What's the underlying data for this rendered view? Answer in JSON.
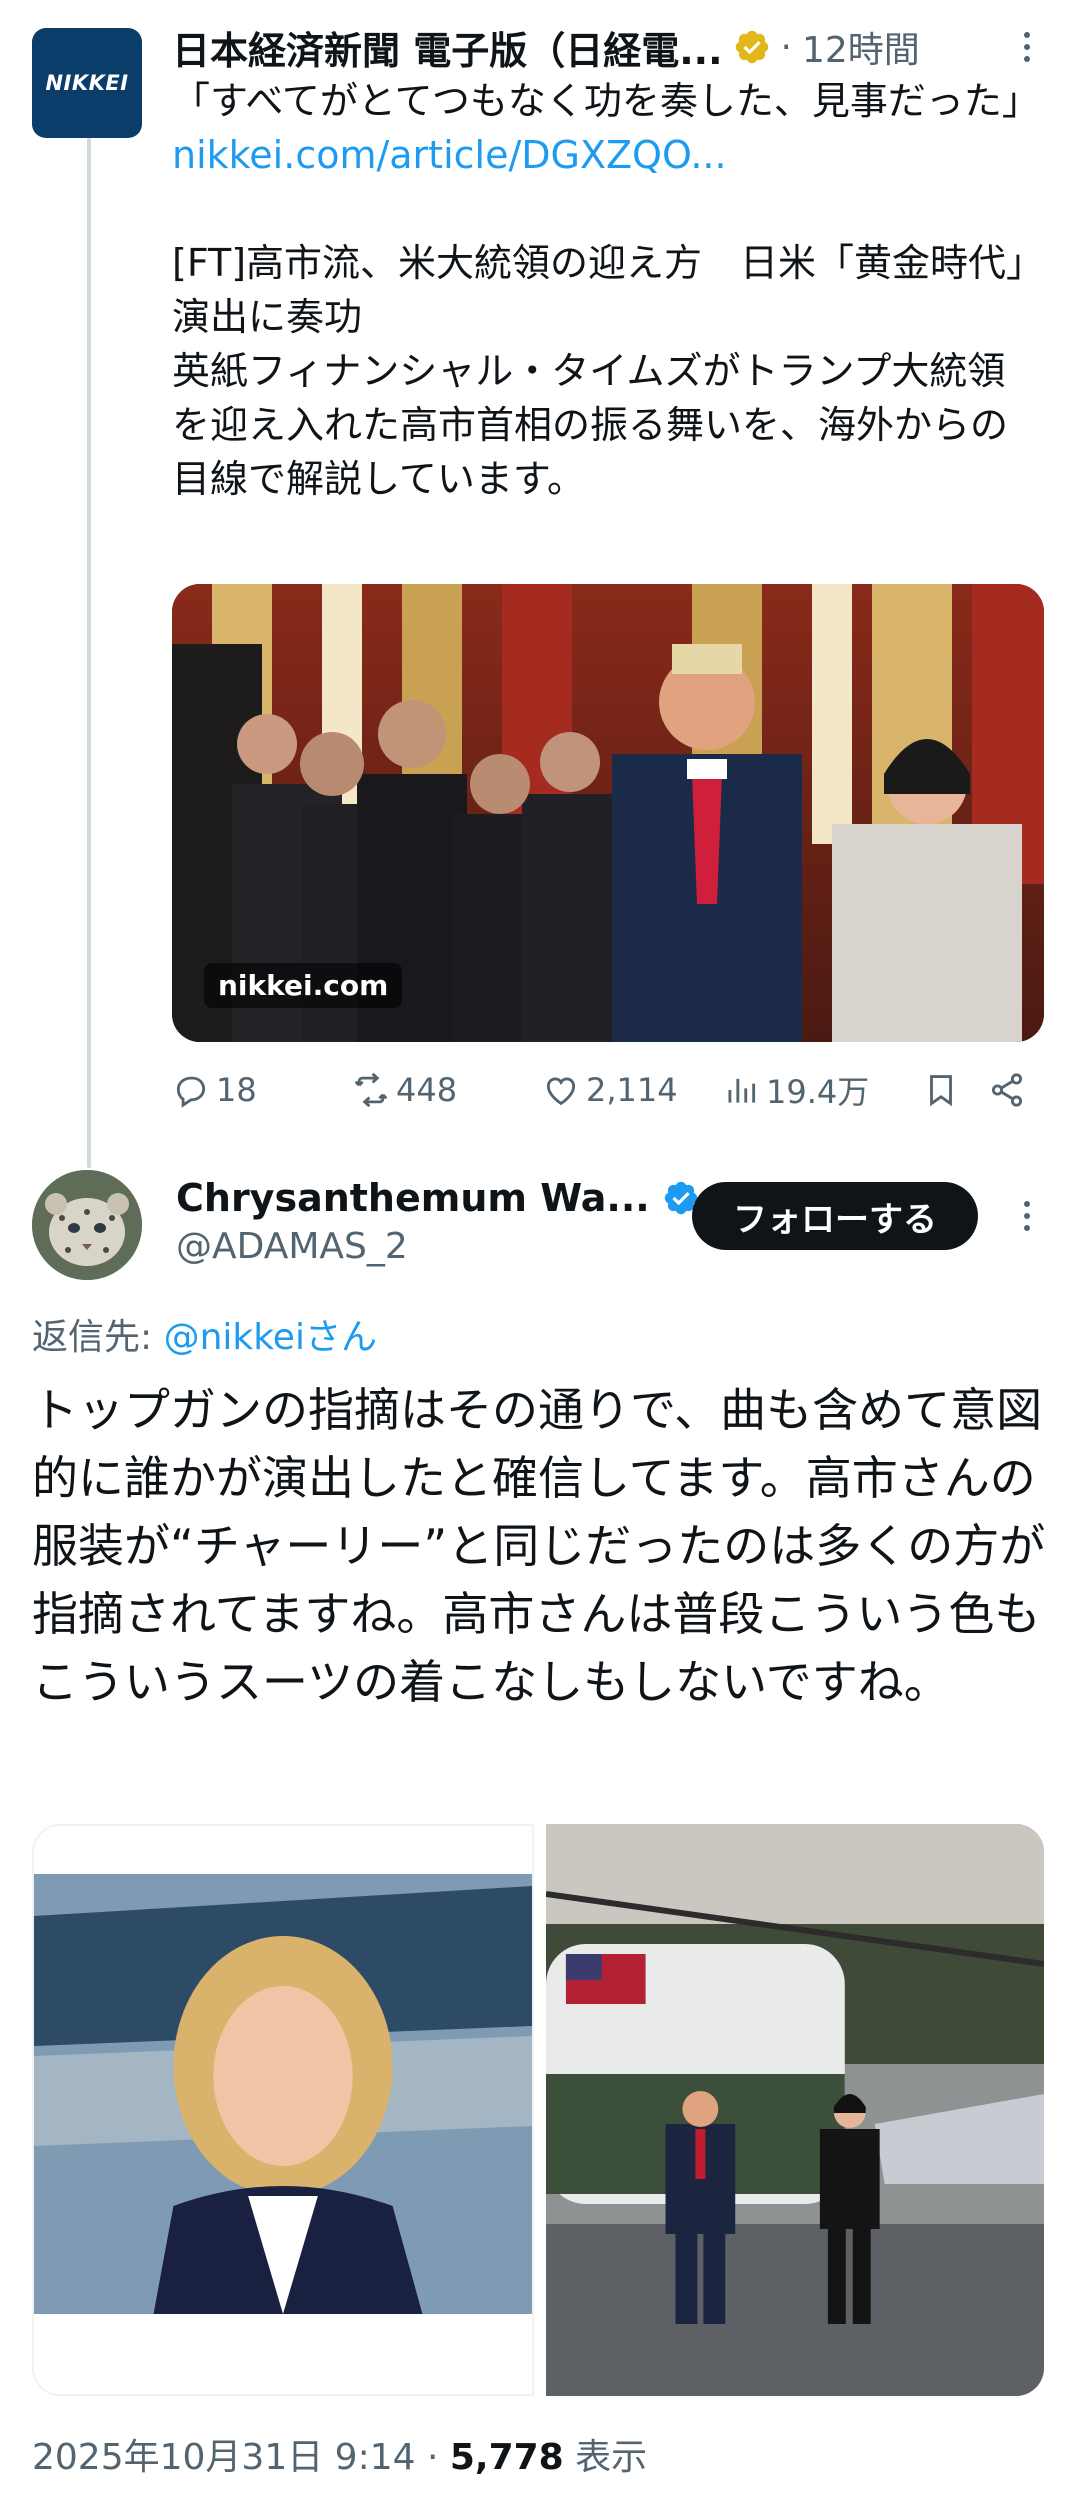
{
  "parent": {
    "avatar_text": "NIKKEI",
    "author_name": "日本経済新聞 電子版（日経電...",
    "separator": "·",
    "time": "12時間",
    "quote_line": "「すべてがとてつもなく功を奏した、見事だった」",
    "link": "nikkei.com/article/DGXZQO...",
    "headline": "[FT]高市流、米大統領の迎え方　日米「黄金時代」演出に奏功",
    "summary": "英紙フィナンシャル・タイムズがトランプ大統領を迎え入れた高市首相の振る舞いを、海外からの目線で解説しています。",
    "media_badge": "nikkei.com",
    "stats": {
      "replies": "18",
      "reposts": "448",
      "likes": "2,114",
      "views": "19.4万"
    }
  },
  "reply": {
    "author_name": "Chrysanthemum Wa...",
    "handle": "@ADAMAS_2",
    "follow_label": "フォローする",
    "reply_to_prefix": "返信先: ",
    "reply_to_mention": "@nikkeiさん",
    "body": "トップガンの指摘はその通りで、曲も含めて意図的に誰かが演出したと確信してます。高市さんの服装が“チャーリー”と同じだったのは多くの方が指摘されてますね。高市さんは普段こういう色もこういうスーツの着こなしもしないですね。",
    "timestamp": "2025年10月31日 9:14 · ",
    "views_count": "5,778",
    "views_label": " 表示"
  },
  "colors": {
    "accent": "#1d9bf0",
    "verified_gold": "#e2b719",
    "text_primary": "#0f1419",
    "text_secondary": "#536471"
  },
  "icons": [
    "verified-badge-gold",
    "verified-badge-blue",
    "reply-icon",
    "repost-icon",
    "like-icon",
    "views-icon",
    "bookmark-icon",
    "share-icon",
    "more-icon"
  ]
}
